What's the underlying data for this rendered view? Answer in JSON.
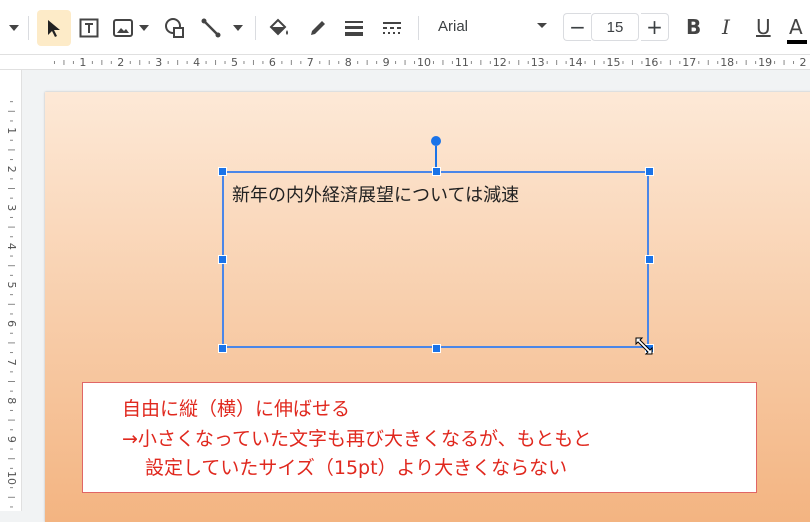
{
  "toolbar": {
    "font_name": "Arial",
    "font_size": "15",
    "decrease_label": "−",
    "increase_label": "+",
    "bold_label": "B",
    "italic_label": "I",
    "underline_label": "U",
    "text_color_label": "A",
    "icons": [
      "caret-down-icon",
      "select-cursor-icon",
      "text-box-icon",
      "image-icon",
      "shape-icon",
      "line-icon",
      "fill-color-icon",
      "border-color-icon",
      "border-weight-icon",
      "border-dash-icon"
    ]
  },
  "ruler": {
    "top_labels": [
      "1",
      "2",
      "3",
      "4",
      "5",
      "6",
      "7",
      "8",
      "9",
      "10",
      "11",
      "12",
      "13",
      "14",
      "15",
      "16",
      "17",
      "18",
      "19",
      "2"
    ],
    "left_labels": [
      "1",
      "2",
      "3",
      "4",
      "5",
      "6",
      "7",
      "8",
      "9",
      "10"
    ]
  },
  "slide": {
    "textbox_text": "新年の内外経済展望については減速",
    "note_lines": [
      "自由に縦（横）に伸ばせる",
      "→小さくなっていた文字も再び大きくなるが、もともと",
      "設定していたサイズ（15pt）より大きくならない"
    ]
  },
  "colors": {
    "selection": "#1a73e8",
    "note_text": "#e0281e",
    "note_border": "#e06666",
    "selected_tool_bg": "#fdebc8"
  }
}
